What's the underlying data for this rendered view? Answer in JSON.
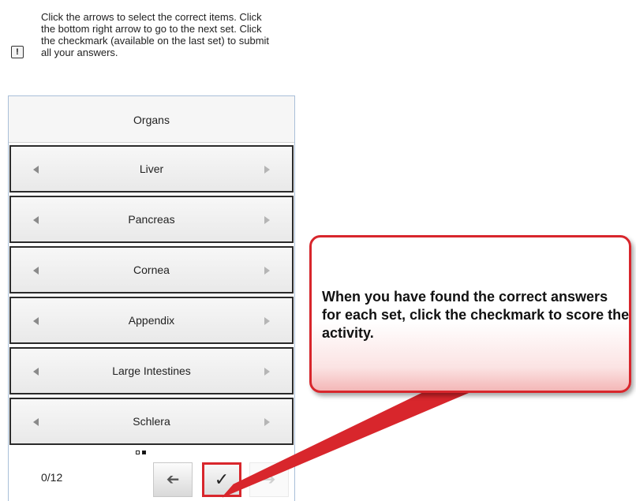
{
  "instructions": "Click the arrows to select the correct items. Click the bottom right arrow to go to the next set. Click the checkmark (available on the last set) to submit all your answers.",
  "info_icon": "info-icon",
  "panel": {
    "header": "Organs",
    "items": [
      {
        "label": "Liver"
      },
      {
        "label": "Pancreas"
      },
      {
        "label": "Cornea"
      },
      {
        "label": "Appendix"
      },
      {
        "label": "Large Intestines"
      },
      {
        "label": "Schlera"
      }
    ]
  },
  "pager": {
    "pages": 2,
    "current": 2
  },
  "score": "0/12",
  "buttons": {
    "prev_icon": "back-arrow-icon",
    "check_icon": "checkmark-icon",
    "next_icon": "next-arrow-icon"
  },
  "callout": {
    "text": "When you have found the correct answers for each set, click the checkmark to score the activity.",
    "accent_color": "#d8262c"
  }
}
